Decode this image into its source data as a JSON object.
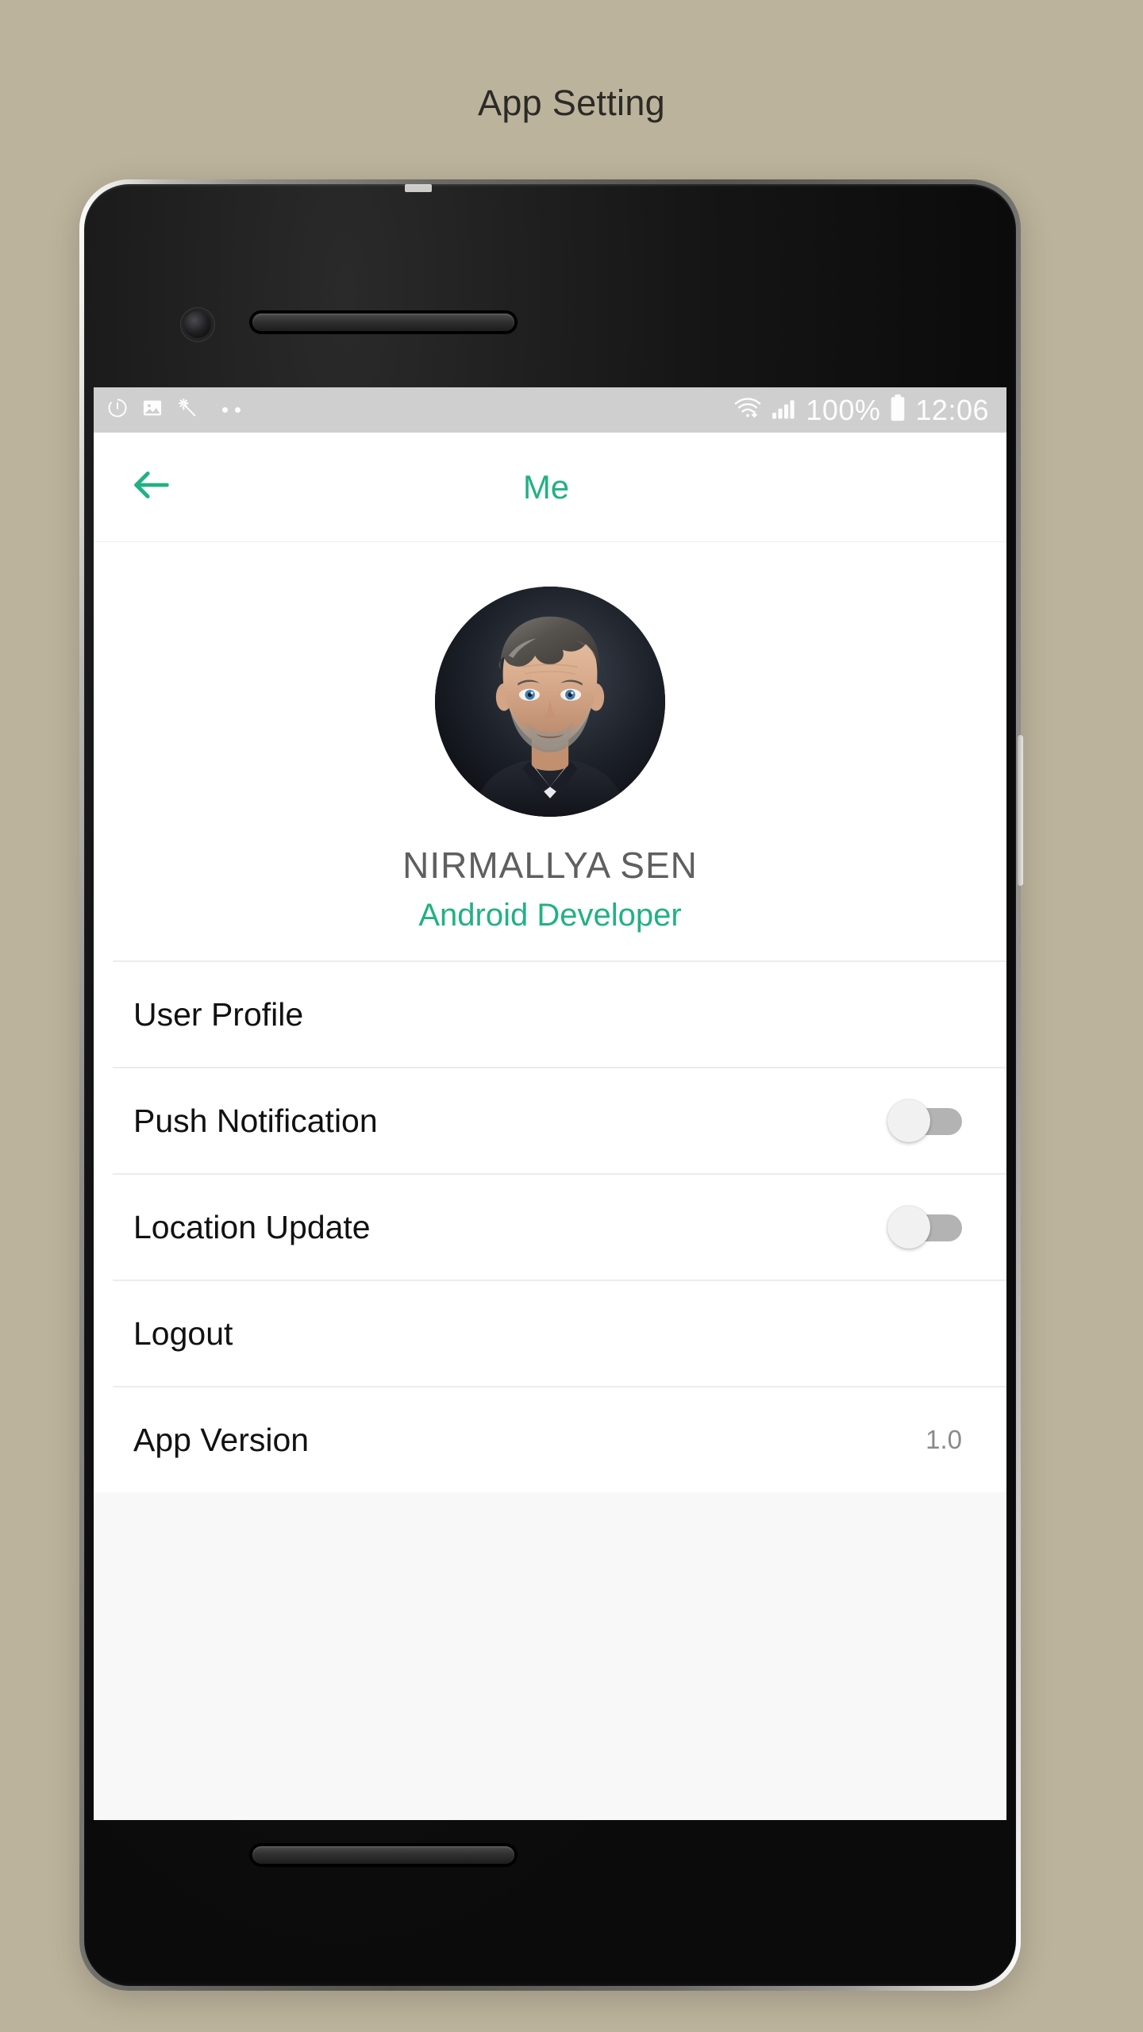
{
  "page": {
    "caption": "App Setting"
  },
  "status_bar": {
    "left_icons": [
      "alarm-timer-icon",
      "image-icon",
      "magic-wand-icon",
      "more-dots-icon"
    ],
    "wifi_icon": "wifi-download-icon",
    "signal_icon": "signal-bars-icon",
    "battery_percent": "100%",
    "battery_icon": "battery-full-icon",
    "time": "12:06"
  },
  "app_bar": {
    "back_icon": "arrow-left-icon",
    "title": "Me",
    "accent_color": "#22b183"
  },
  "profile": {
    "avatar_alt": "user-avatar",
    "name": "NIRMALLYA SEN",
    "role": "Android Developer",
    "name_color": "#5f5f5f",
    "role_color": "#22b183"
  },
  "settings": {
    "rows": [
      {
        "label": "User Profile",
        "type": "link",
        "value": ""
      },
      {
        "label": "Push Notification",
        "type": "toggle",
        "value": "off"
      },
      {
        "label": "Location Update",
        "type": "toggle",
        "value": "off"
      },
      {
        "label": "Logout",
        "type": "link",
        "value": ""
      },
      {
        "label": "App Version",
        "type": "value",
        "value": "1.0"
      }
    ]
  },
  "theme": {
    "background": "#bcb39c",
    "screen_background": "#fafafa",
    "status_bar_background": "#cfcfcf",
    "accent": "#22b183",
    "divider": "#ececec"
  }
}
